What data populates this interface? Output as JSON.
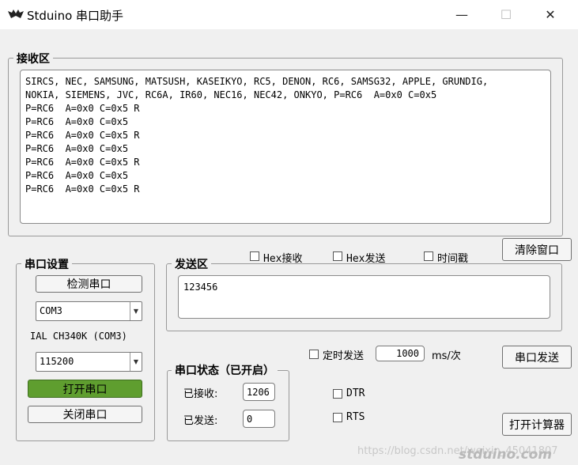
{
  "window": {
    "title": "Stduino 串口助手",
    "minimize": "—",
    "maximize": "☐",
    "close": "✕"
  },
  "receive": {
    "title": "接收区",
    "lines": [
      "SIRCS, NEC, SAMSUNG, MATSUSH, KASEIKYO, RC5, DENON, RC6, SAMSG32, APPLE, GRUNDIG,",
      "NOKIA, SIEMENS, JVC, RC6A, IR60, NEC16, NEC42, ONKYO, P=RC6  A=0x0 C=0x5",
      "P=RC6  A=0x0 C=0x5 R",
      "P=RC6  A=0x0 C=0x5",
      "P=RC6  A=0x0 C=0x5 R",
      "P=RC6  A=0x0 C=0x5",
      "P=RC6  A=0x0 C=0x5 R",
      "P=RC6  A=0x0 C=0x5",
      "P=RC6  A=0x0 C=0x5 R"
    ]
  },
  "options": {
    "hex_receive": "Hex接收",
    "hex_send": "Hex发送",
    "timestamp": "时间戳",
    "clear_window": "清除窗口"
  },
  "serial_settings": {
    "title": "串口设置",
    "detect_button": "检测串口",
    "port": "COM3",
    "device_label": "IAL CH340K (COM3)",
    "baud": "115200",
    "open_button": "打开串口",
    "close_button": "关闭串口"
  },
  "send": {
    "title": "发送区",
    "text": "123456",
    "timed_send_label": "定时发送",
    "interval": "1000",
    "unit": "ms/次",
    "send_button": "串口发送"
  },
  "status": {
    "title": "串口状态（已开启）",
    "received_label": "已接收:",
    "received_value": "1206",
    "sent_label": "已发送:",
    "sent_value": "0"
  },
  "signals": {
    "dtr": "DTR",
    "rts": "RTS"
  },
  "calculator_button": "打开计算器",
  "watermark": "https://blog.csdn.net/weixin_45041807",
  "watermark_logo": "stduino.com"
}
